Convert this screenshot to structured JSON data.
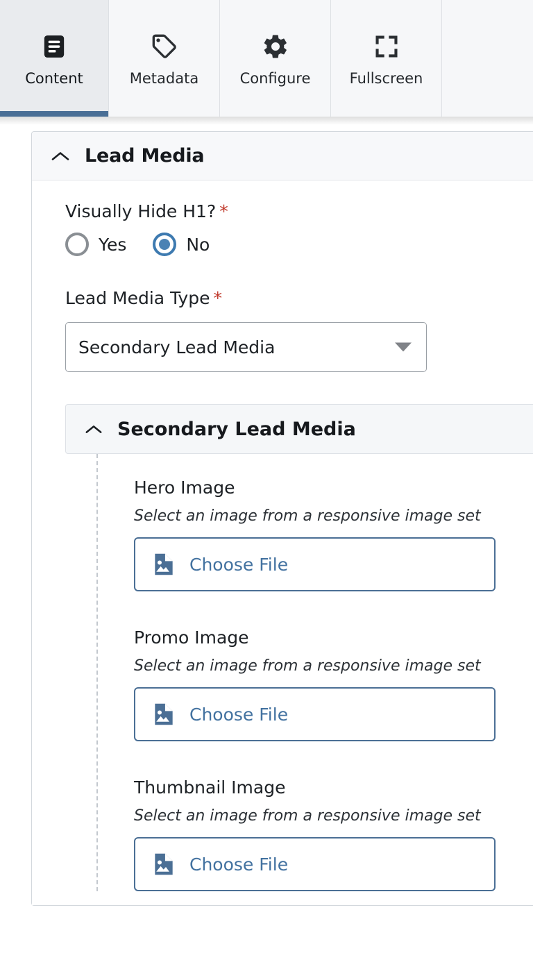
{
  "tabs": [
    {
      "label": "Content",
      "icon": "article-icon",
      "active": true
    },
    {
      "label": "Metadata",
      "icon": "tag-icon",
      "active": false
    },
    {
      "label": "Configure",
      "icon": "gear-icon",
      "active": false
    },
    {
      "label": "Fullscreen",
      "icon": "fullscreen-icon",
      "active": false
    }
  ],
  "panel": {
    "title": "Lead Media",
    "collapse_icon": "chevron-up-icon",
    "fields": {
      "visually_hide": {
        "label": "Visually Hide H1?",
        "required_marker": "*",
        "options": [
          {
            "label": "Yes",
            "selected": false
          },
          {
            "label": "No",
            "selected": true
          }
        ]
      },
      "lead_media_type": {
        "label": "Lead Media Type",
        "required_marker": "*",
        "value": "Secondary Lead Media",
        "dropdown_icon": "chevron-down-icon"
      }
    },
    "subsection": {
      "title": "Secondary Lead Media",
      "collapse_icon": "chevron-up-icon",
      "media_fields": [
        {
          "label": "Hero Image",
          "description": "Select an image from a responsive image set",
          "button_label": "Choose File",
          "button_icon": "file-image-icon"
        },
        {
          "label": "Promo Image",
          "description": "Select an image from a responsive image set",
          "button_label": "Choose File",
          "button_icon": "file-image-icon"
        },
        {
          "label": "Thumbnail Image",
          "description": "Select an image from a responsive image set",
          "button_label": "Choose File",
          "button_icon": "file-image-icon"
        }
      ]
    }
  },
  "colors": {
    "active_tab_underline": "#4a6f96",
    "active_tab_bg": "#e9ebee",
    "tab_bg": "#f6f7f9",
    "required_asterisk": "#c0392b",
    "radio_selected": "#4b82b4",
    "button_border": "#4b6f95",
    "button_text": "#4372a0",
    "panel_header_bg": "#f7f8fa"
  }
}
